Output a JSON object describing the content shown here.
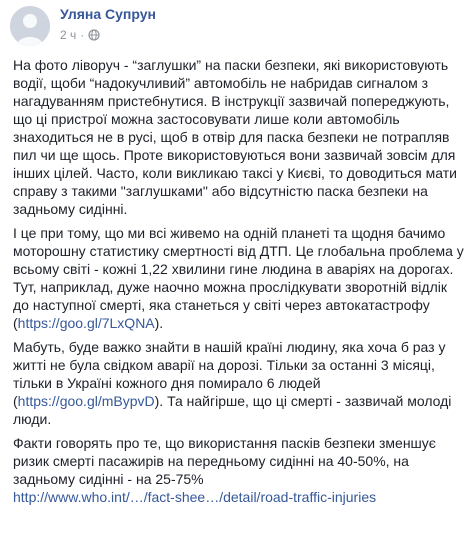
{
  "post": {
    "author": "Уляна Супрун",
    "time": "2 ч",
    "separator": "·",
    "audience_icon": "globe-icon",
    "paragraphs": [
      {
        "text": "На фото ліворуч - “заглушки” на паски безпеки, які використовують водії, щоби “надокучливий” автомобіль не набридав сигналом з нагадуванням пристебнутися. В інструкції зазвичай попереджують, що ці пристрої можна застосовувати лише коли автомобіль знаходиться не в русі, щоб в отвір для паска безпеки не потрапляв пил чи ще щось. Проте використовуються вони зазвичай зовсім для інших цілей. Часто, коли викликаю таксі у Києві, то доводиться мати справу з такими \"заглушками\" або відсутністю паска безпеки на задньому сидінні."
      },
      {
        "text": "І це при тому, що ми всі живемо на одній планеті та щодня бачимо моторошну статистику смертності від ДТП. Це глобальна проблема у всьому світі - кожні 1,22 хвилини гине людина в аваріях на дорогах. Тут, наприклад, дуже наочно можна прослідкувати зворотній відлік до наступної смерті, яка станеться у світі через автокатастрофу (",
        "link": "https://goo.gl/7LxQNA",
        "after": ")."
      },
      {
        "text": "Мабуть, буде важко знайти в нашій країні людину, яка хоча б раз у житті не була свідком аварії на дорозі. Тільки за останні 3 місяці, тільки в Україні кожного дня помирало 6 людей (",
        "link": "https://goo.gl/mBypvD",
        "after": "). Та найгірше, що ці смерті - зазвичай молоді люди."
      },
      {
        "text": "Факти говорять про те, що використання пасків безпеки зменшує ризик смерті пасажирів на передньому сидінні на 40-50%, на задньому сидінні - на 25-75%",
        "link": "http://www.who.int/…/fact-shee…/detail/road-traffic-injuries",
        "after": ""
      }
    ]
  },
  "colors": {
    "link": "#365899",
    "text": "#1d2129",
    "meta": "#90949c"
  }
}
